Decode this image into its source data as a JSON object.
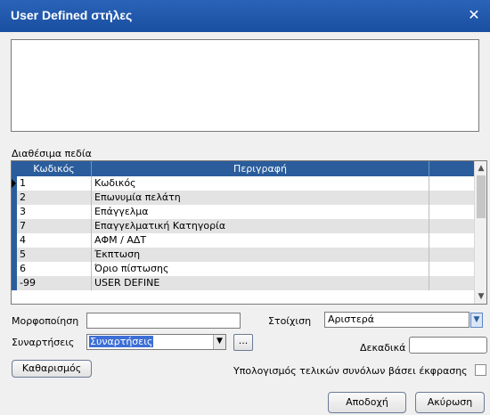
{
  "window": {
    "title": "User Defined στήλες",
    "close_glyph": "✕"
  },
  "fields_grid": {
    "caption": "Διαθέσιμα πεδία",
    "columns": [
      "Κωδικός",
      "Περιγραφή"
    ],
    "rows": [
      [
        "1",
        "Κωδικός"
      ],
      [
        "2",
        "Επωνυμία πελάτη"
      ],
      [
        "3",
        "Επάγγελμα"
      ],
      [
        "7",
        "Επαγγελματική Κατηγορία"
      ],
      [
        "4",
        "ΑΦΜ / ΑΔΤ"
      ],
      [
        "5",
        "Έκπτωση"
      ],
      [
        "6",
        "Όριο πίστωσης"
      ],
      [
        "-99",
        "USER DEFINE"
      ]
    ]
  },
  "format_label": "Μορφοποίηση",
  "format_value": "",
  "alignment_label": "Στοίχιση",
  "alignment_value": "Αριστερά",
  "functions_label": "Συναρτήσεις",
  "functions_value": "Συναρτήσεις",
  "ellipsis_label": "...",
  "decimals_label": "Δεκαδικά",
  "decimals_value": "",
  "clear_button": "Καθαρισμός",
  "totals_checkbox_label": "Υπολογισμός τελικών συνόλων βάσει έκφρασης",
  "ok_button": "Αποδοχή",
  "cancel_button": "Ακύρωση"
}
